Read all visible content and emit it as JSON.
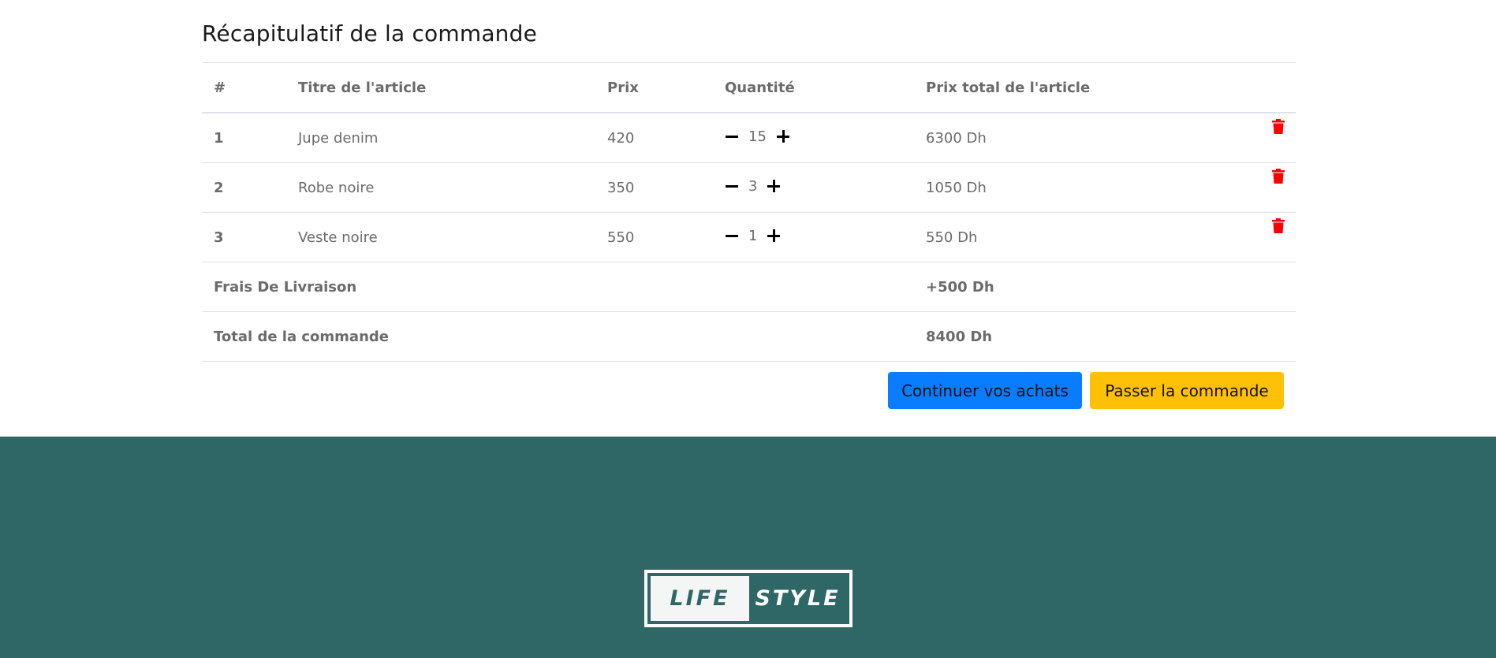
{
  "page": {
    "title": "Récapitulatif de la commande"
  },
  "table": {
    "headers": [
      "#",
      "Titre de l'article",
      "Prix",
      "Quantité",
      "Prix total de l'article"
    ],
    "rows": [
      {
        "num": "1",
        "title": "Jupe denim",
        "price": "420",
        "qty": "15",
        "total": "6300 Dh"
      },
      {
        "num": "2",
        "title": "Robe noire",
        "price": "350",
        "qty": "3",
        "total": "1050 Dh"
      },
      {
        "num": "3",
        "title": "Veste noire",
        "price": "550",
        "qty": "1",
        "total": "550 Dh"
      }
    ],
    "delivery": {
      "label": "Frais De Livraison",
      "value": "+500 Dh"
    },
    "order_total": {
      "label": "Total de la commande",
      "value": "8400 Dh"
    }
  },
  "actions": {
    "continue_label": "Continuer vos achats",
    "checkout_label": "Passer la commande"
  },
  "footer": {
    "logo_left": "LIFE",
    "logo_right": "STYLE"
  },
  "colors": {
    "footer_bg": "#2f6666",
    "primary": "#0a7cff",
    "warning": "#ffc107",
    "danger": "#ff0000"
  },
  "icons": {
    "decrease": "minus-icon",
    "increase": "plus-icon",
    "remove": "trash-icon"
  }
}
